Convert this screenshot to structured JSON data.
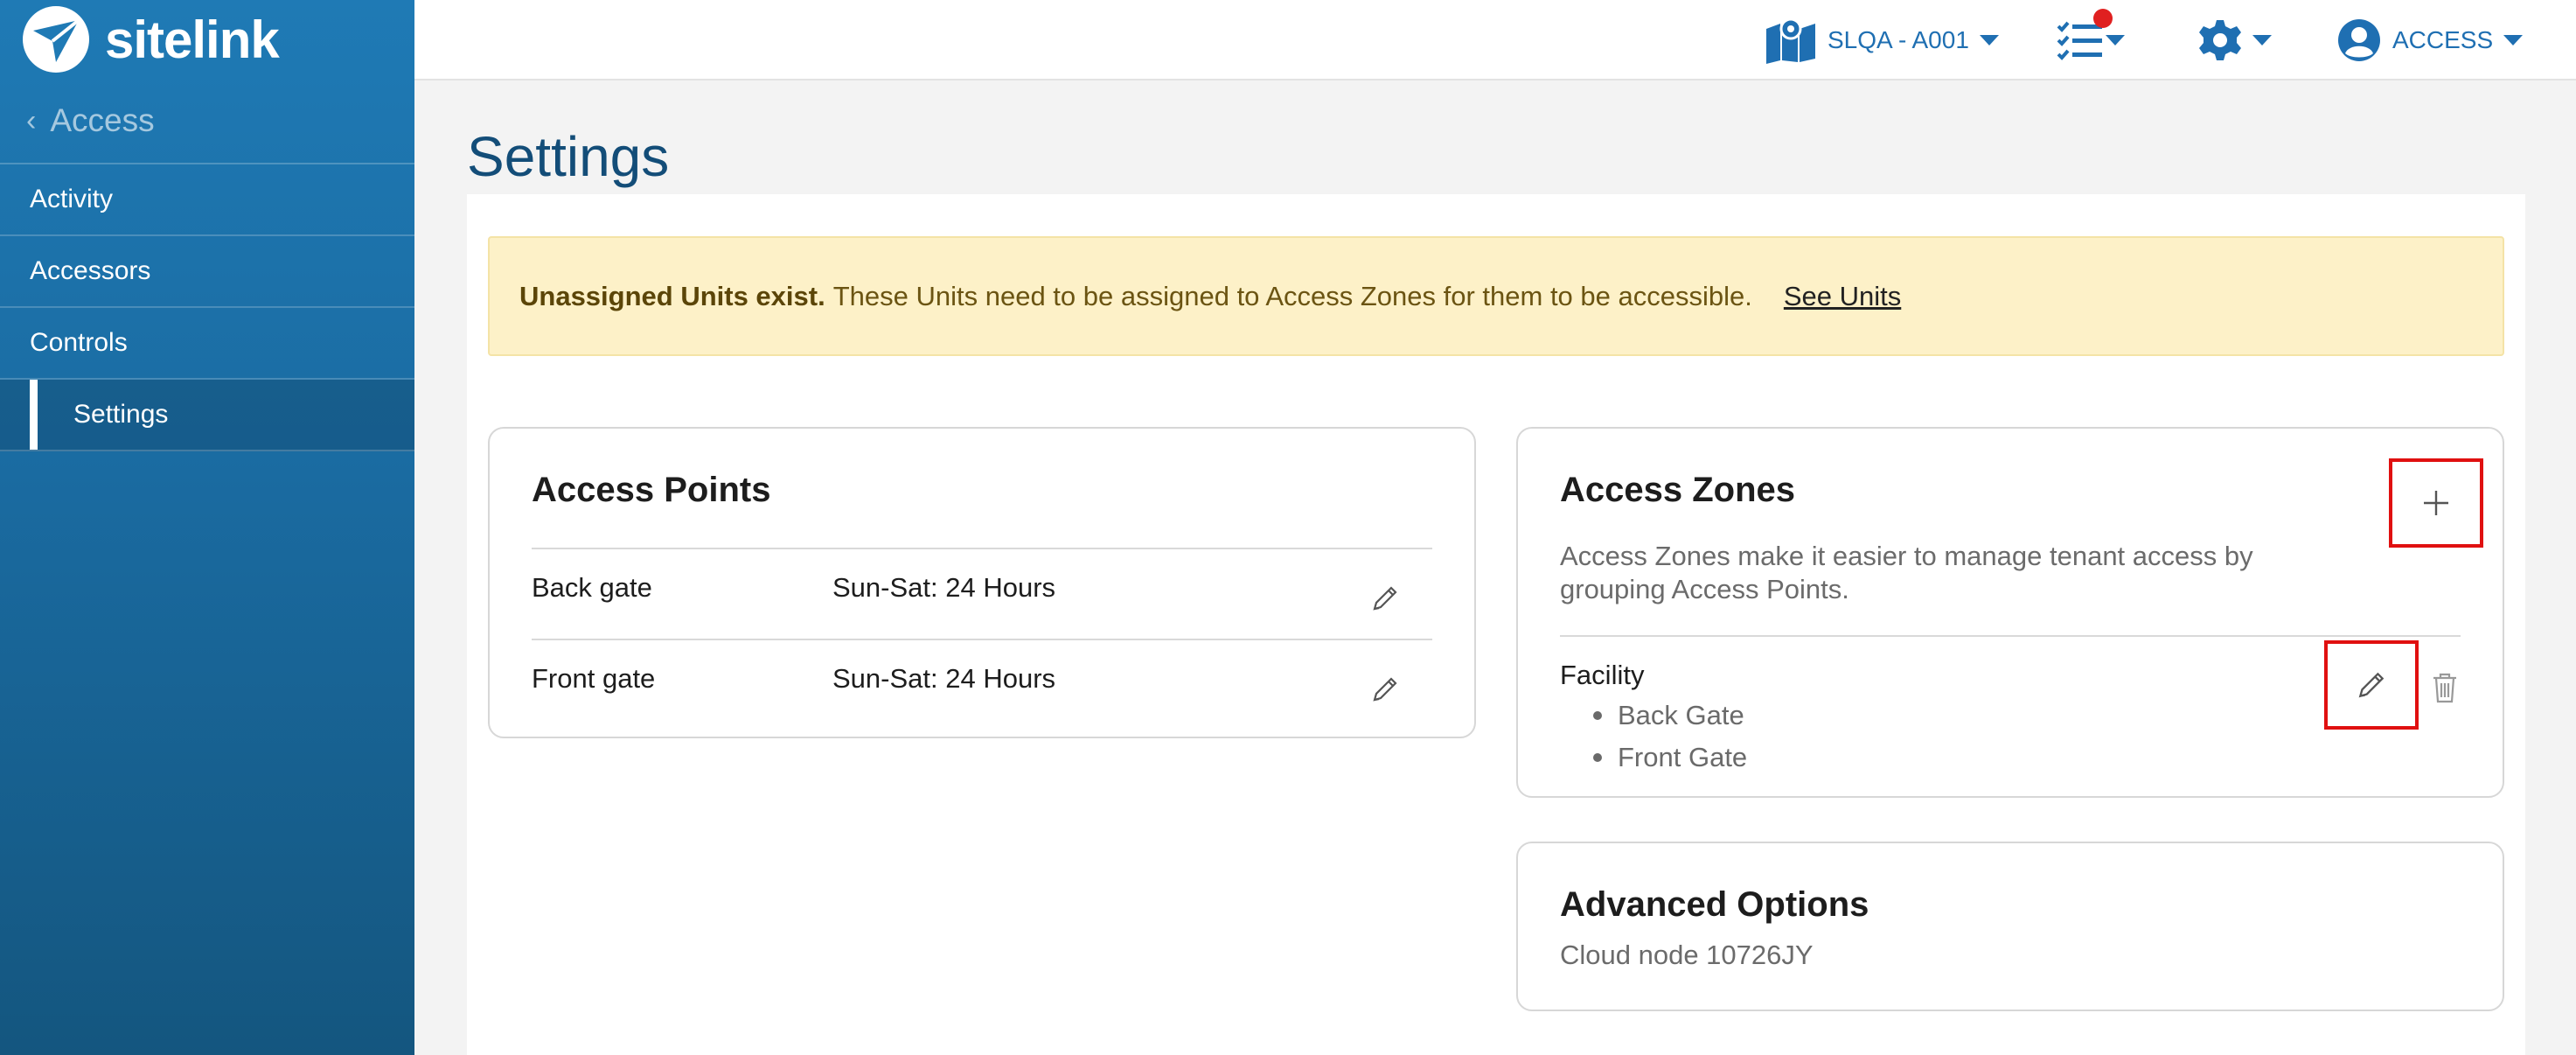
{
  "brand": {
    "name": "sitelink"
  },
  "sidebar": {
    "back_label": "Access",
    "items": [
      {
        "label": "Activity"
      },
      {
        "label": "Accessors"
      },
      {
        "label": "Controls"
      },
      {
        "label": "Settings",
        "active": true
      }
    ]
  },
  "topbar": {
    "location_label": "SLQA - A001",
    "user_label": "ACCESS"
  },
  "page": {
    "title": "Settings"
  },
  "alert": {
    "bold_text": "Unassigned Units exist.",
    "text": "These Units need to be assigned to Access Zones for them to be accessible.",
    "link_label": "See Units"
  },
  "access_points": {
    "title": "Access Points",
    "rows": [
      {
        "name": "Back gate",
        "schedule": "Sun-Sat: 24 Hours"
      },
      {
        "name": "Front gate",
        "schedule": "Sun-Sat: 24 Hours"
      }
    ]
  },
  "access_zones": {
    "title": "Access Zones",
    "description_line1": "Access Zones make it easier to manage tenant access by",
    "description_line2": "grouping Access Points.",
    "zones": [
      {
        "name": "Facility",
        "points": [
          "Back Gate",
          "Front Gate"
        ]
      }
    ]
  },
  "advanced_options": {
    "title": "Advanced Options",
    "cloud_node": "Cloud node 10726JY"
  },
  "colors": {
    "sidebar_top": "#1f7ab5",
    "sidebar_bottom": "#14567f",
    "link_blue": "#1f6fb2",
    "title_blue": "#134d78",
    "alert_bg": "#fdf1c8",
    "highlight_red": "#e01010",
    "notification_red": "#e02020"
  },
  "icons": [
    "logo-icon",
    "chevron-left-icon",
    "map-pin-icon",
    "checklist-icon",
    "gear-icon",
    "user-circle-icon",
    "pencil-icon",
    "plus-icon",
    "trash-icon"
  ]
}
